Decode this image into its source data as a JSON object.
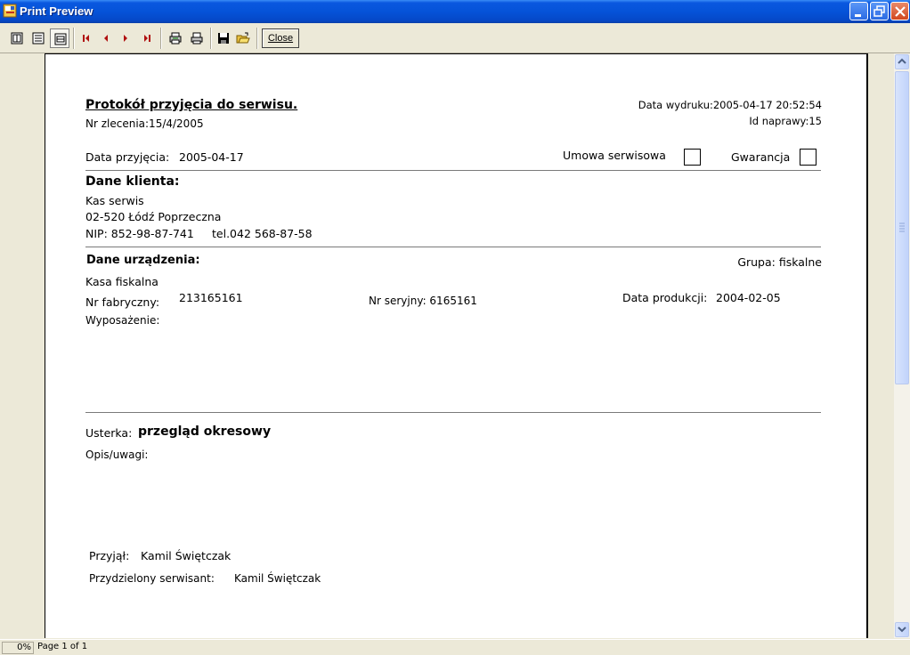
{
  "window": {
    "title": "Print Preview"
  },
  "toolbar": {
    "close_label": "Close"
  },
  "report": {
    "title": "Protokół przyjęcia do serwisu.",
    "order_no": "Nr zlecenia:15/4/2005",
    "print_date": "Data wydruku:2005-04-17 20:52:54",
    "repair_id": "Id naprawy:15",
    "receipt_date_label": "Data przyjęcia:",
    "receipt_date": "2005-04-17",
    "service_contract_label": "Umowa serwisowa",
    "warranty_label": "Gwarancja",
    "client_header": "Dane klienta:",
    "client_name": "Kas serwis",
    "client_address": "02-520 Łódź Poprzeczna",
    "client_nip": "NIP: 852-98-87-741",
    "client_tel": "tel.042 568-87-58",
    "device_header": "Dane urządzenia:",
    "group": "Grupa: fiskalne",
    "device_name": "Kasa fiskalna",
    "factory_no_label": "Nr fabryczny:",
    "factory_no": "213165161",
    "serial_no": "Nr seryjny: 6165161",
    "production_date_label": "Data produkcji:",
    "production_date": "2004-02-05",
    "equipment_label": "Wyposażenie:",
    "fault_label": "Usterka:",
    "fault_value": "przegląd okresowy",
    "notes_label": "Opis/uwagi:",
    "received_by_label": "Przyjął:",
    "received_by": "Kamil Świętczak",
    "assigned_tech_label": "Przydzielony serwisant:",
    "assigned_tech": "Kamil Świętczak"
  },
  "status": {
    "zoom": "0%",
    "page": "Page 1 of 1"
  }
}
